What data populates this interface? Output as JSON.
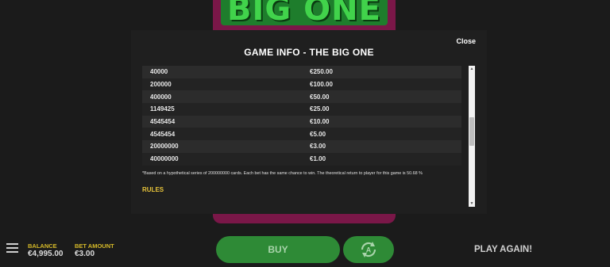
{
  "background": {
    "logo_text": "BIG ONE"
  },
  "modal": {
    "close_label": "Close",
    "title": "GAME INFO - THE BIG ONE",
    "prize_rows": [
      {
        "count": "40000",
        "prize": "€250.00"
      },
      {
        "count": "200000",
        "prize": "€100.00"
      },
      {
        "count": "400000",
        "prize": "€50.00"
      },
      {
        "count": "1149425",
        "prize": "€25.00"
      },
      {
        "count": "4545454",
        "prize": "€10.00"
      },
      {
        "count": "4545454",
        "prize": "€5.00"
      },
      {
        "count": "20000000",
        "prize": "€3.00"
      },
      {
        "count": "40000000",
        "prize": "€1.00"
      }
    ],
    "footnote": "*Based on a hypothetical series of 200000000 cards. Each bet has the same chance to win. The theoretical return to player for this game is 50.68 %",
    "rules_heading": "RULES",
    "scroll_position": 0.45
  },
  "bottom_bar": {
    "balance_label": "BALANCE",
    "balance_value": "€4,995.00",
    "bet_label": "BET AMOUNT",
    "bet_value": "€3.00",
    "buy_label": "BUY",
    "play_again_label": "PLAY AGAIN!",
    "menu_icon": "hamburger-menu-icon",
    "autoplay_icon": "autoplay-icon"
  },
  "colors": {
    "accent_green": "#2e8a36",
    "label_yellow": "#d5b928",
    "rules_yellow": "#e8c43a",
    "art_magenta": "#7a1748"
  }
}
